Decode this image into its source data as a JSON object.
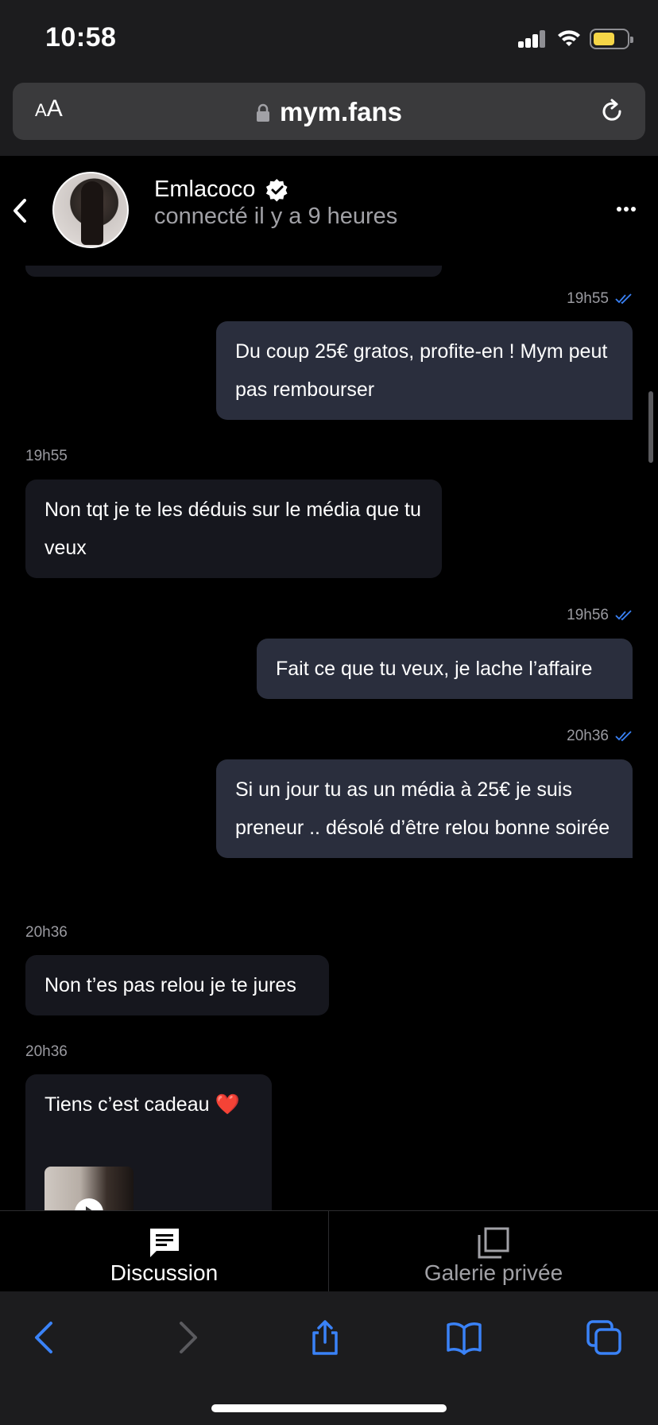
{
  "status_bar": {
    "time": "10:58"
  },
  "browser": {
    "url": "mym.fans",
    "aa_small": "A",
    "aa_large": "A"
  },
  "contact": {
    "name": "Emlacoco",
    "status": "connecté il y a 9 heures"
  },
  "messages": [
    {
      "direction": "out",
      "time": "19h55",
      "text": "Du coup 25€ gratos, profite-en ! Mym peut pas rembourser"
    },
    {
      "direction": "in",
      "time": "19h55",
      "text": "Non tqt je te les déduis sur le média que tu veux"
    },
    {
      "direction": "out",
      "time": "19h56",
      "text": "Fait ce que tu veux, je lache l’affaire"
    },
    {
      "direction": "out",
      "time": "20h36",
      "text": "Si un jour tu as un média à 25€ je suis preneur .. désolé d’être relou bonne soirée"
    },
    {
      "direction": "in",
      "time": "20h36",
      "text": "Non t’es pas relou je te jures"
    },
    {
      "direction": "in",
      "time": "20h36",
      "text": "Tiens c’est cadeau ❤️"
    }
  ],
  "tabs": [
    {
      "label": "Discussion",
      "active": true
    },
    {
      "label": "Galerie privée",
      "active": false
    }
  ],
  "colors": {
    "accent_blue": "#3a82f7",
    "outgoing_bubble": "#2a2e3d",
    "incoming_bubble": "#16171e",
    "battery_yellow": "#f5d547"
  },
  "icons": [
    "lock-icon",
    "reload-icon",
    "back-arrow-icon",
    "verified-icon",
    "more-icon",
    "double-check-icon",
    "chat-icon",
    "gallery-icon",
    "share-icon",
    "bookmarks-icon",
    "tabs-icon",
    "play-icon"
  ]
}
